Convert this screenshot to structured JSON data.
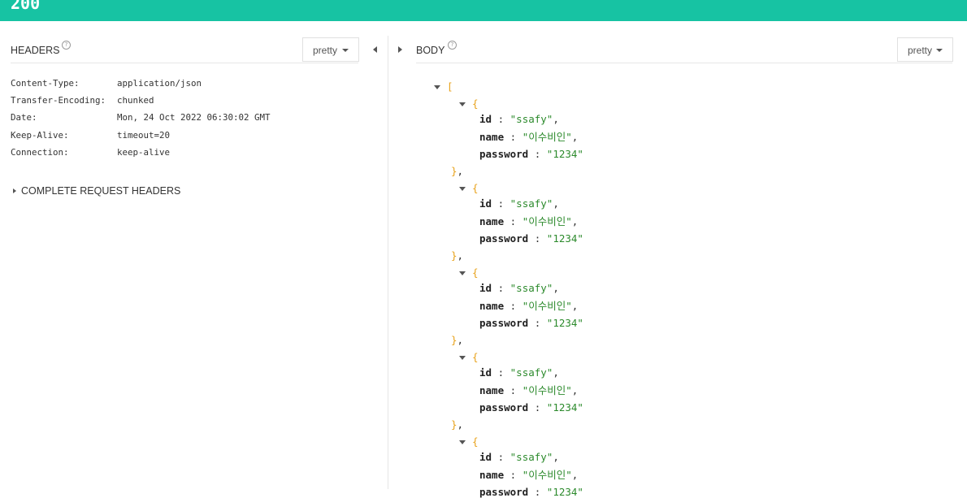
{
  "status": {
    "code": "200",
    "color": "#17c3a3"
  },
  "headers_panel": {
    "title": "HEADERS",
    "help_glyph": "?",
    "view_mode": "pretty",
    "rows": [
      {
        "key": "Content-Type:",
        "value": "application/json"
      },
      {
        "key": "Transfer-Encoding:",
        "value": "chunked"
      },
      {
        "key": "Date:",
        "value": "Mon, 24 Oct 2022 06:30:02 GMT"
      },
      {
        "key": "Keep-Alive:",
        "value": "timeout=20"
      },
      {
        "key": "Connection:",
        "value": "keep-alive"
      }
    ],
    "complete_request_label": "COMPLETE REQUEST HEADERS"
  },
  "body_panel": {
    "title": "BODY",
    "help_glyph": "?",
    "view_mode": "pretty",
    "open_bracket": "[",
    "items": [
      {
        "id": "\"ssafy\"",
        "name": "\"이수비인\"",
        "password": "\"1234\""
      },
      {
        "id": "\"ssafy\"",
        "name": "\"이수비인\"",
        "password": "\"1234\""
      },
      {
        "id": "\"ssafy\"",
        "name": "\"이수비인\"",
        "password": "\"1234\""
      },
      {
        "id": "\"ssafy\"",
        "name": "\"이수비인\"",
        "password": "\"1234\""
      },
      {
        "id": "\"ssafy\"",
        "name": "\"이수비인\"",
        "password": "\"1234\""
      }
    ]
  }
}
